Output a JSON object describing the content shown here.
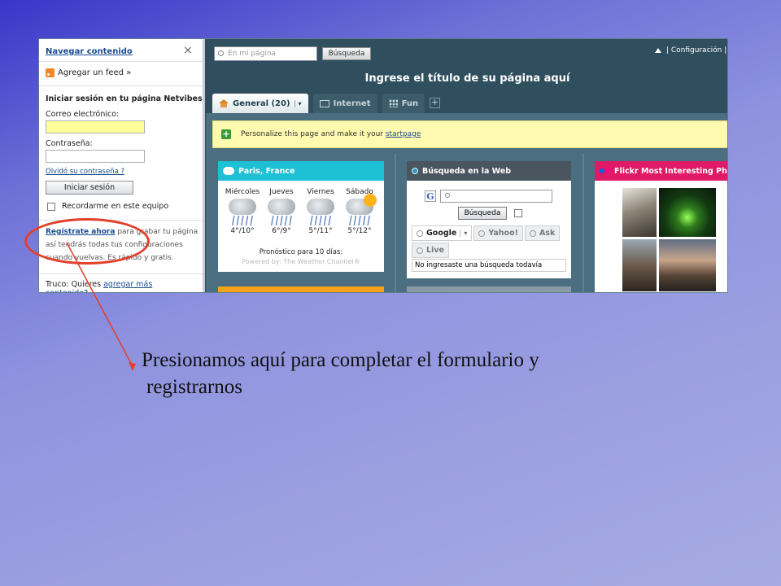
{
  "sidebar": {
    "heading": "Navegar contenido",
    "close_icon": "×",
    "add_feed": "Agregar un feed »",
    "login_title": "Iniciar sesión en tu página Netvibes",
    "email_label": "Correo electrónico:",
    "email_value": "",
    "password_label": "Contraseña:",
    "password_value": "",
    "forgot": "Olvidó su contraseña ?",
    "login_button": "Iniciar sesión",
    "remember": "Recordarme en este equipo",
    "register_link": "Regístrate ahora",
    "register_text": " para grabar tu página así tendrás todas tus configuraciones cuando vuelvas. Es rápido y gratis.",
    "tip_prefix": "Truco: Quieres ",
    "tip_link": "agregar más contenido",
    "tip_suffix": "?"
  },
  "topbar": {
    "search_placeholder": "En mi página",
    "search_button": "Búsqueda",
    "config": "| Configuración |"
  },
  "page": {
    "title": "Ingrese el título de su página aquí"
  },
  "tabs": [
    {
      "label": "General (20)",
      "icon": "house-icon",
      "active": true
    },
    {
      "label": "Internet",
      "icon": "monitor-icon",
      "active": false
    },
    {
      "label": "Fun",
      "icon": "grid-icon",
      "active": false
    }
  ],
  "add_tab": "+",
  "notice": {
    "text": "Personalize this page and make it your ",
    "link": "startpage"
  },
  "weather": {
    "title": "Paris, France",
    "header_color": "#1ec0d6",
    "days": [
      {
        "name": "Miércoles",
        "temp": "4°/10°"
      },
      {
        "name": "Jueves",
        "temp": "6°/9°"
      },
      {
        "name": "Viernes",
        "temp": "5°/11°"
      },
      {
        "name": "Sábado",
        "temp": "5°/12°"
      }
    ],
    "forecast": "Pronóstico para 10 días:",
    "powered": "Powered by: The Weather Channel®"
  },
  "websearch": {
    "title": "Búsqueda en la Web",
    "header_color": "#4a5560",
    "g_logo": "G",
    "input_value": "",
    "button": "Búsqueda",
    "engines": [
      "Google",
      "Yahoo!",
      "Ask",
      "Live"
    ],
    "empty": "No ingresaste una búsqueda todavía"
  },
  "flickr": {
    "title": "Flickr Most Interesting Photo",
    "header_color": "#e01a67",
    "dot_colors": [
      "#0063dc",
      "#ff0084"
    ]
  },
  "colors": {
    "strip_orange": "#f7a21c",
    "strip_gray": "#8a9aa4",
    "annotation_red": "#e2402a"
  },
  "caption": {
    "line1": "Presionamos aquí para completar el formulario y",
    "line2": "registrarnos"
  }
}
